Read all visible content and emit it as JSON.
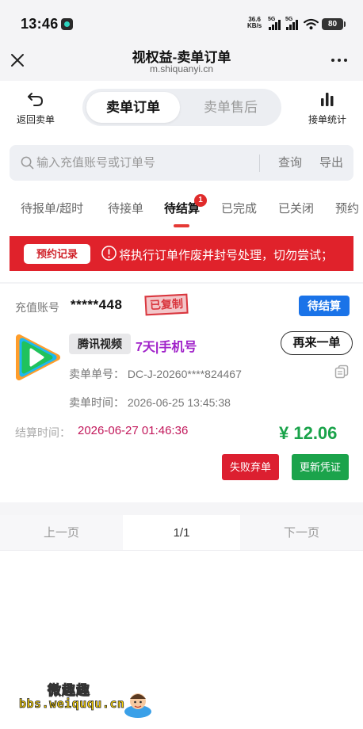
{
  "status_bar": {
    "time": "13:46",
    "net_speed_value": "36.6",
    "net_speed_unit": "KB/s",
    "sim1": "5G",
    "sim2": "5G",
    "battery": "80"
  },
  "title_bar": {
    "title": "视权益-卖单订单",
    "url": "m.shiquanyi.cn"
  },
  "toolbar": {
    "back_label": "返回卖单",
    "tabs": [
      "卖单订单",
      "卖单售后"
    ],
    "active_tab": "卖单订单",
    "stats_label": "接单统计"
  },
  "search": {
    "placeholder": "输入充值账号或订单号",
    "query_label": "查询",
    "export_label": "导出"
  },
  "status_tabs": {
    "items": [
      "待报单/超时",
      "待接单",
      "待结算",
      "已完成",
      "已关闭",
      "预约"
    ],
    "active": "待结算",
    "badge": "1"
  },
  "notice": {
    "tag": "预约记录",
    "text": "将执行订单作废并封号处理，切勿尝试；"
  },
  "order": {
    "account_label": "充值账号",
    "account_value": "*****448",
    "copied_stamp": "已复制",
    "status": "待结算",
    "platform": "腾讯视频",
    "product": "7天|手机号",
    "reorder_label": "再来一单",
    "order_no": "卖单单号： DC-J-20260****824467",
    "order_time": "卖单时间： 2026-06-25 13:45:38",
    "settle_label": "结算时间：",
    "settle_time": "2026-06-27 01:46:36",
    "amount": "¥ 12.06",
    "abandon_label": "失败弃单",
    "update_label": "更新凭证"
  },
  "pager": {
    "prev": "上一页",
    "info": "1/1",
    "next": "下一页"
  },
  "watermark": {
    "line1": "微趣趣",
    "line2": "bbs.weiququ.cn"
  },
  "colors": {
    "accent_red": "#e0222b",
    "status_blue": "#1a73e8",
    "amount_green": "#1aa34a",
    "product_purple": "#a021c9",
    "settle_pink": "#c2185b"
  },
  "icons": [
    "back-arrow-icon",
    "bar-chart-icon",
    "search-icon",
    "alert-circle-icon",
    "copy-icon",
    "close-icon",
    "more-icon",
    "wifi-icon",
    "tencent-video-logo"
  ]
}
